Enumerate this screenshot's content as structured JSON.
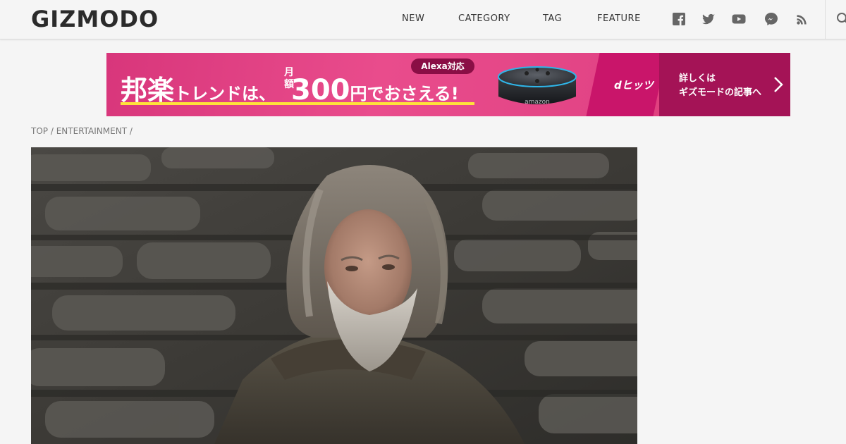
{
  "header": {
    "logo": "GIZMODO",
    "nav": [
      {
        "label": "NEW"
      },
      {
        "label": "CATEGORY"
      },
      {
        "label": "TAG"
      },
      {
        "label": "FEATURE"
      }
    ],
    "social_icons": [
      "facebook-icon",
      "twitter-icon",
      "youtube-icon",
      "messenger-icon",
      "rss-icon"
    ],
    "search_icon": "search-icon"
  },
  "ad": {
    "headline_part1": "邦楽",
    "headline_part2": "トレンドは、",
    "monthly_label_top": "月",
    "monthly_label_bottom": "額",
    "price_number": "300",
    "price_unit": "円",
    "headline_part3": "でおさえる!",
    "badge": "Alexa対応",
    "product_label": "amazon",
    "brand": "dヒッツ",
    "cta_line1": "詳しくは",
    "cta_line2": "ギズモードの記事へ",
    "colors": {
      "pink": "#e0407f",
      "magenta": "#c9156a",
      "dark": "#a41356",
      "underline": "#ffe23a"
    }
  },
  "breadcrumb": {
    "items": [
      "TOP",
      "ENTERTAINMENT"
    ],
    "separator": "/"
  }
}
